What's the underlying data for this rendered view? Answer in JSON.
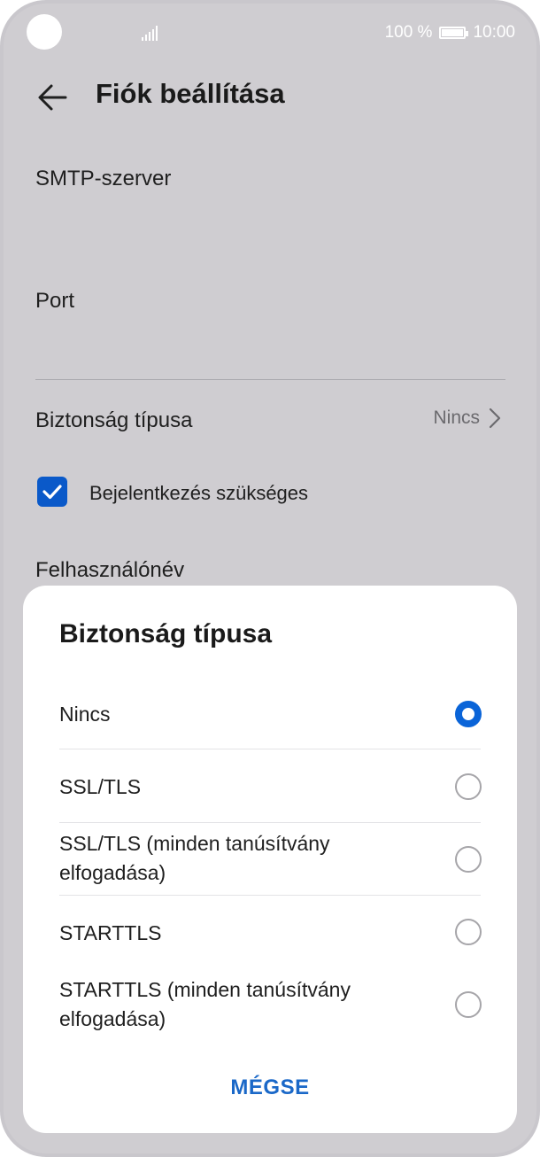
{
  "status": {
    "battery_text": "100 %",
    "time": "10:00"
  },
  "appbar": {
    "title": "Fiók beállítása"
  },
  "settings": {
    "smtp_label": "SMTP-szerver",
    "port_label": "Port",
    "security_label": "Biztonság típusa",
    "security_value": "Nincs",
    "login_required_label": "Bejelentkezés szükséges",
    "username_label": "Felhasználónév"
  },
  "dialog": {
    "title": "Biztonság típusa",
    "options": [
      {
        "label": "Nincs",
        "selected": true
      },
      {
        "label": "SSL/TLS",
        "selected": false
      },
      {
        "label": "SSL/TLS (minden tanúsítvány elfogadása)",
        "selected": false
      },
      {
        "label": "STARTTLS",
        "selected": false
      },
      {
        "label": "STARTTLS (minden tanúsítvány elfogadása)",
        "selected": false
      }
    ],
    "cancel_label": "MÉGSE"
  },
  "colors": {
    "accent": "#0a64d8",
    "scrim": "#cfcdd1"
  }
}
